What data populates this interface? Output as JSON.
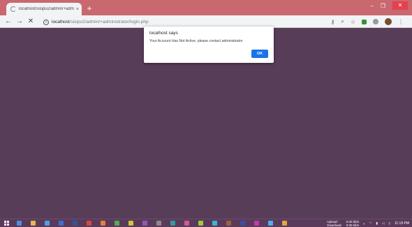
{
  "browser": {
    "tab_title": "localhost/sisipu2/admin/+adm",
    "tab_close": "×",
    "new_tab": "+",
    "window_controls": {
      "minimize": "–",
      "maximize": "❐",
      "close": "✕"
    },
    "nav": {
      "back": "←",
      "forward": "→",
      "stop": "✕"
    },
    "url_host": "localhost",
    "url_path": "/sisipu2/admin/+administrator/login.php"
  },
  "alert": {
    "title": "localhost says",
    "message": "Your Account Has Not Active, please contact administrator",
    "ok_label": "OK"
  },
  "taskbar": {
    "net_upload": "Upload:",
    "net_download": "Download:",
    "upload_speed": "0.00 kb/s",
    "download_speed": "0.00 kb/s",
    "clock": "11:19 PM",
    "apps": [
      {
        "name": "file-explorer",
        "color": "#4f8fd8"
      },
      {
        "name": "folder",
        "color": "#e5b84c"
      },
      {
        "name": "chrome",
        "color": "#4aa3df"
      },
      {
        "name": "app-blue",
        "color": "#3b6fd4"
      },
      {
        "name": "app-word",
        "color": "#2b579a"
      },
      {
        "name": "app-red",
        "color": "#d44a3a"
      },
      {
        "name": "app-orange",
        "color": "#e5822f"
      },
      {
        "name": "app-green",
        "color": "#4caf50"
      },
      {
        "name": "app-yellow",
        "color": "#d9c23a"
      },
      {
        "name": "app-purple",
        "color": "#8e5ab8"
      },
      {
        "name": "app-gray",
        "color": "#8a8a8a"
      },
      {
        "name": "app-teal",
        "color": "#2f9e9e"
      },
      {
        "name": "app-pink",
        "color": "#d9558a"
      },
      {
        "name": "app-lime",
        "color": "#9ccc3a"
      },
      {
        "name": "app-cyan",
        "color": "#35b7d9"
      },
      {
        "name": "app-brown",
        "color": "#a0603a"
      },
      {
        "name": "app-navy",
        "color": "#3a4fa0"
      },
      {
        "name": "app-magenta",
        "color": "#c03aa8"
      },
      {
        "name": "app-sky",
        "color": "#4ab0e8"
      },
      {
        "name": "app-amber",
        "color": "#e8a33a"
      }
    ]
  },
  "colors": {
    "desktop_bg": "#583d58",
    "titlebar": "#c9686f",
    "ok_button": "#1a73e8"
  }
}
